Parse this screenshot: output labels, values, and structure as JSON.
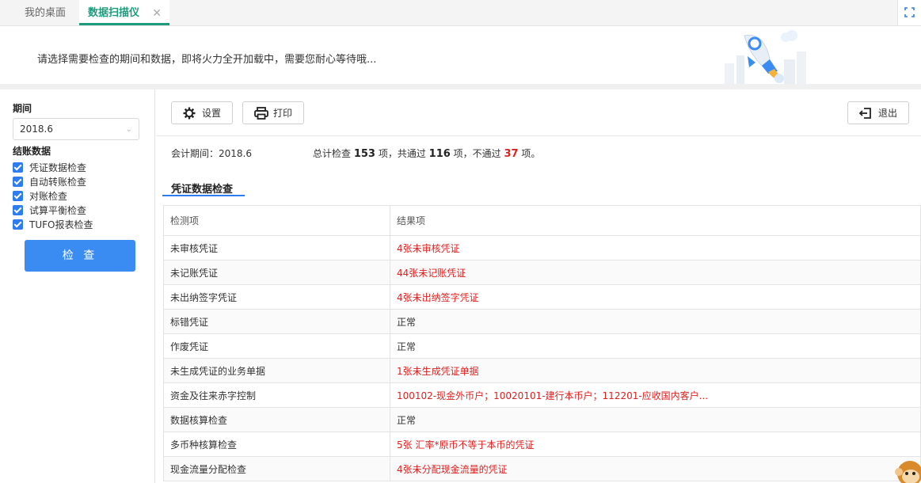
{
  "tabs": [
    {
      "label": "我的桌面"
    },
    {
      "label": "数据扫描仪",
      "close": "✕"
    }
  ],
  "banner": {
    "text": "请选择需要检查的期间和数据，即将火力全开加载中，需要您耐心等待哦..."
  },
  "sidebar": {
    "period_label": "期间",
    "period_value": "2018.6",
    "data_label": "结账数据",
    "checks": [
      {
        "label": "凭证数据检查"
      },
      {
        "label": "自动转账检查"
      },
      {
        "label": "对账检查"
      },
      {
        "label": "试算平衡检查"
      },
      {
        "label": "TUFO报表检查"
      }
    ],
    "check_button": "检 查"
  },
  "toolbar": {
    "settings": "设置",
    "print": "打印",
    "exit": "退出"
  },
  "summary": {
    "period_text": "会计期间：2018.6",
    "total_prefix": "总计检查",
    "total": "153",
    "passed_prefix": "项，共通过",
    "passed": "116",
    "failed_prefix": "项，不通过",
    "failed": "37",
    "suffix": "项。"
  },
  "section": {
    "title": "凭证数据检查"
  },
  "table": {
    "headers": [
      "检测项",
      "结果项"
    ],
    "rows": [
      {
        "item": "未审核凭证",
        "result": "4张未审核凭证",
        "status": "error"
      },
      {
        "item": "未记账凭证",
        "result": "44张未记账凭证",
        "status": "error"
      },
      {
        "item": "未出纳签字凭证",
        "result": "4张未出纳签字凭证",
        "status": "error"
      },
      {
        "item": "标错凭证",
        "result": "正常",
        "status": "ok"
      },
      {
        "item": "作废凭证",
        "result": "正常",
        "status": "ok"
      },
      {
        "item": "未生成凭证的业务单据",
        "result": "1张未生成凭证单据",
        "status": "error"
      },
      {
        "item": "资金及往来赤字控制",
        "result": "100102-现金外币户；10020101-建行本币户；112201-应收国内客户...",
        "status": "error"
      },
      {
        "item": "数据核算检查",
        "result": "正常",
        "status": "ok"
      },
      {
        "item": "多币种核算检查",
        "result": "5张 汇率*原币不等于本币的凭证",
        "status": "error"
      },
      {
        "item": "现金流量分配检查",
        "result": "4张未分配现金流量的凭证",
        "status": "error"
      }
    ]
  },
  "colors": {
    "accent": "#2d7df0",
    "tab_active": "#1d9b7c",
    "error": "#e02020"
  }
}
